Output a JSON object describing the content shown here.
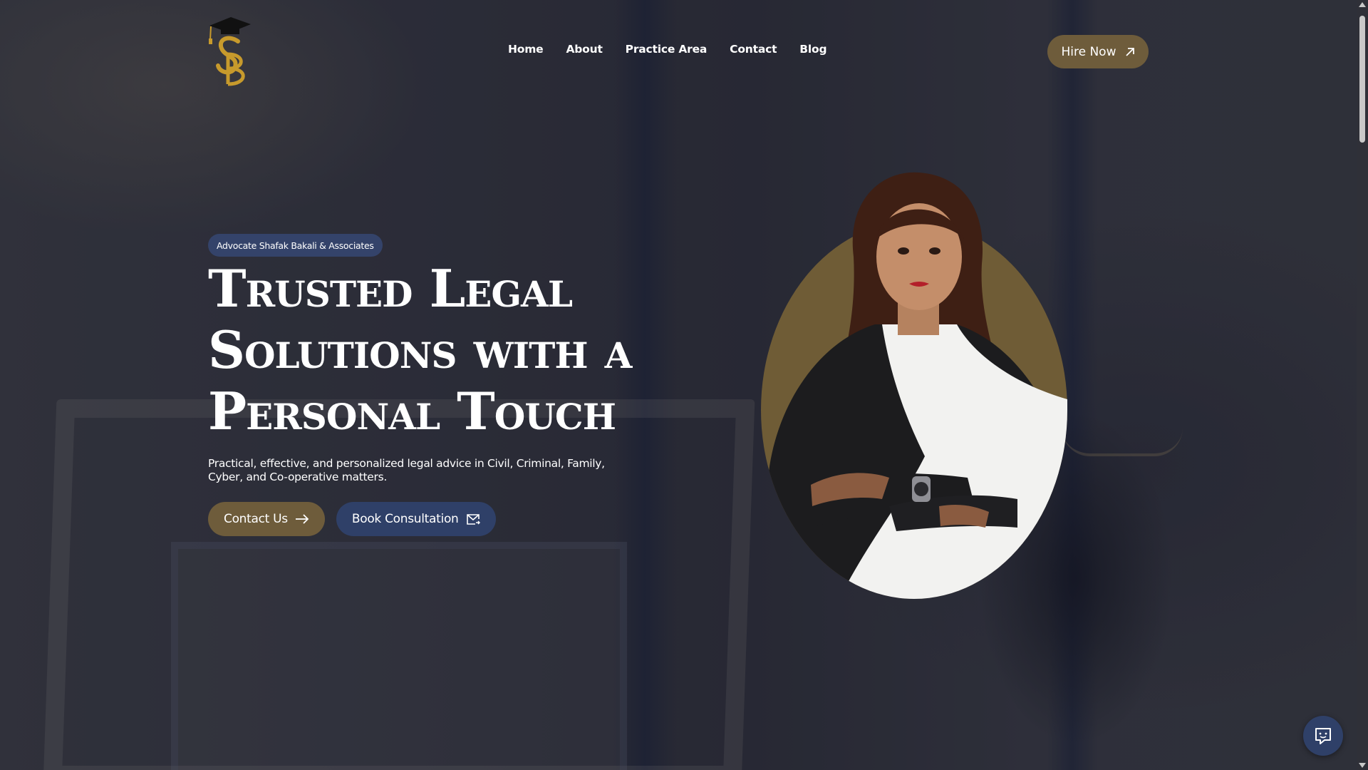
{
  "brand": {
    "logo_icon": "graduation-cap-monogram-logo",
    "accent_color": "#6e5c3b",
    "navy_color": "#2f4068"
  },
  "nav": {
    "items": [
      {
        "label": "Home"
      },
      {
        "label": "About"
      },
      {
        "label": "Practice Area"
      },
      {
        "label": "Contact"
      },
      {
        "label": "Blog"
      }
    ],
    "hire_label": "Hire Now",
    "hire_icon": "arrow-up-right-icon"
  },
  "hero": {
    "badge": "Advocate Shafak Bakali & Associates",
    "headline_lines": [
      "Trusted Legal",
      "Solutions with a",
      "Personal Touch"
    ],
    "subtext_line1": "Practical, effective, and personalized legal advice in Civil, Criminal, Family,",
    "subtext_line2": "Cyber, and Co-operative matters.",
    "cta_primary": {
      "label": "Contact Us",
      "icon": "arrow-right-icon"
    },
    "cta_secondary": {
      "label": "Book Consultation",
      "icon": "mail-send-icon"
    }
  },
  "chat": {
    "icon": "chat-bubble-icon"
  }
}
